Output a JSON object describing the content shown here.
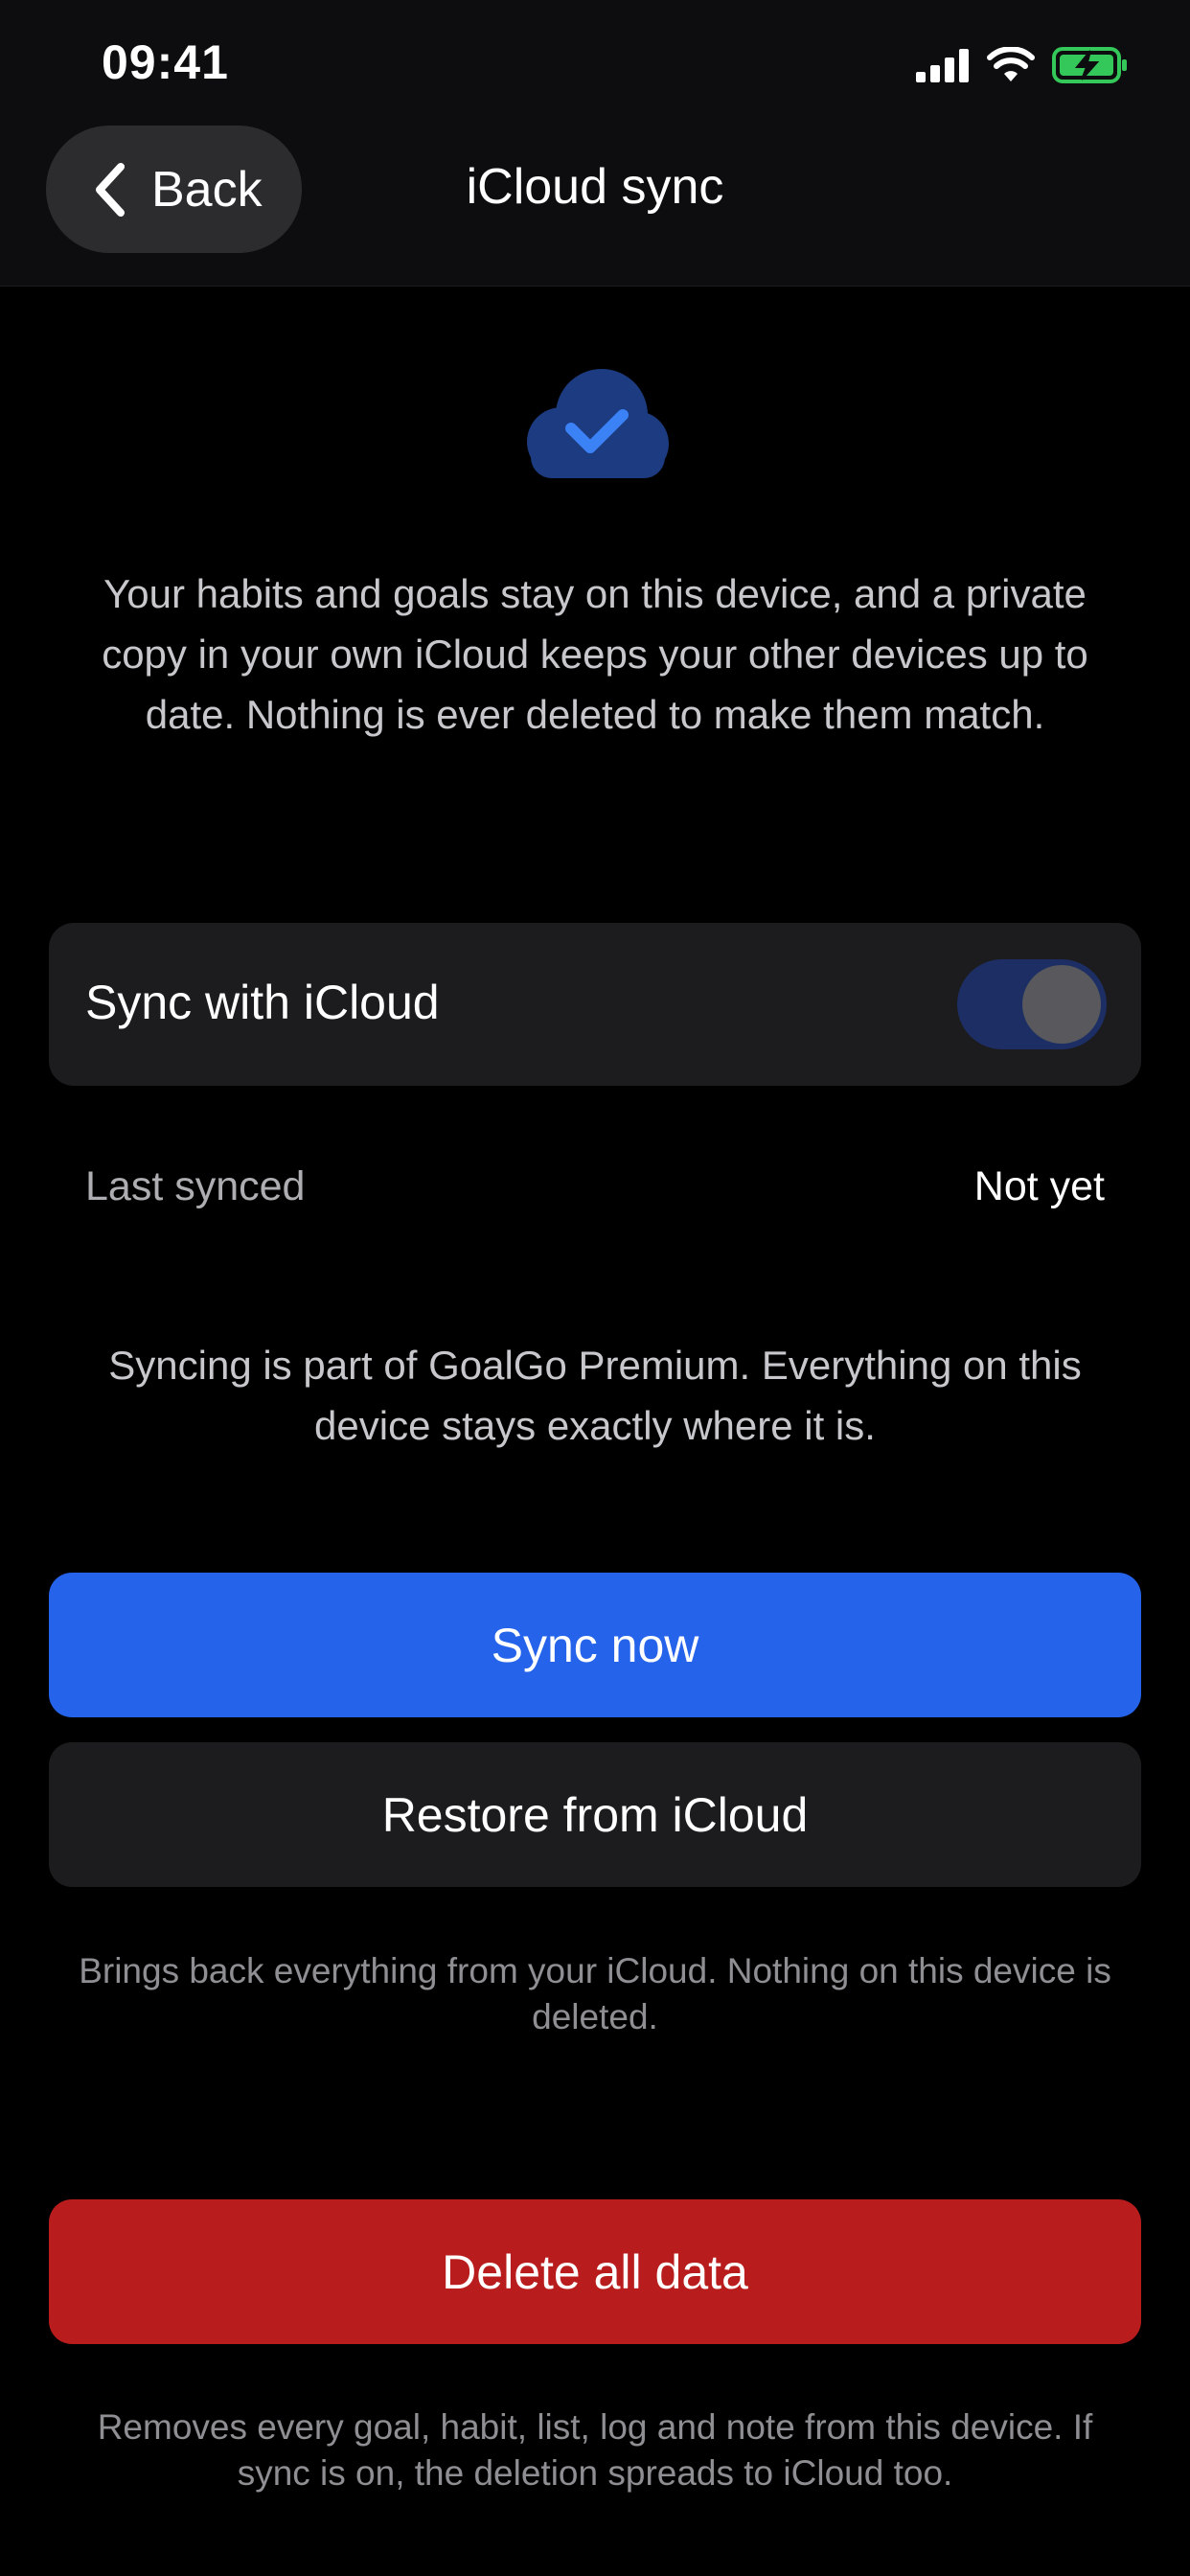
{
  "status_bar": {
    "time": "09:41",
    "icons": [
      "cellular-signal-icon",
      "wifi-icon",
      "battery-charging-icon"
    ]
  },
  "nav": {
    "back_label": "Back",
    "title": "iCloud sync"
  },
  "header_icon": "cloud-checkmark-icon",
  "intro_text": "Your habits and goals stay on this device, and a private copy in your own iCloud keeps your other devices up to date. Nothing is ever deleted to make them match.",
  "sync_toggle": {
    "label": "Sync with iCloud",
    "state": "on"
  },
  "last_synced": {
    "label": "Last synced",
    "value": "Not yet"
  },
  "premium_note": "Syncing is part of GoalGo Premium. Everything on this device stays exactly where it is.",
  "buttons": {
    "sync_now": "Sync now",
    "restore": "Restore from iCloud",
    "delete_all": "Delete all data"
  },
  "restore_hint": "Brings back everything from your iCloud. Nothing on this device is deleted.",
  "delete_hint": "Removes every goal, habit, list, log and note from this device. If sync is on, the deletion spreads to iCloud too.",
  "colors": {
    "background": "#000000",
    "nav_background": "#0d0d0f",
    "card": "#1c1c1e",
    "accent_blue": "#2563eb",
    "toggle_track": "#1c2e63",
    "danger_red": "#b91c1c",
    "battery_green": "#34c759"
  }
}
